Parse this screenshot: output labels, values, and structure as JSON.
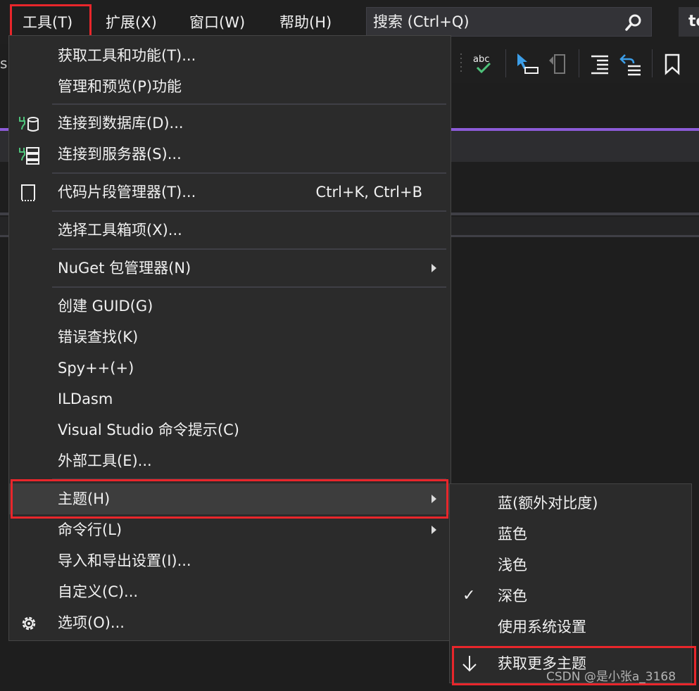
{
  "menubar": {
    "tools": "工具(T)",
    "extensions": "扩展(X)",
    "window": "窗口(W)",
    "help": "帮助(H)",
    "search_placeholder": "搜索 (Ctrl+Q)",
    "title_fragment": "te"
  },
  "background": {
    "left_letter": "s"
  },
  "tools_menu": {
    "items": [
      {
        "label": "获取工具和功能(T)..."
      },
      {
        "label": "管理和预览(P)功能"
      },
      {
        "label": "连接到数据库(D)...",
        "icon": "database-connect-icon"
      },
      {
        "label": "连接到服务器(S)...",
        "icon": "server-connect-icon"
      },
      {
        "label": "代码片段管理器(T)...",
        "icon": "snippet-icon",
        "shortcut": "Ctrl+K, Ctrl+B"
      },
      {
        "label": "选择工具箱项(X)..."
      },
      {
        "label": "NuGet 包管理器(N)",
        "has_submenu": true
      },
      {
        "label": "创建 GUID(G)"
      },
      {
        "label": "错误查找(K)"
      },
      {
        "label": "Spy++(+)"
      },
      {
        "label": "ILDasm"
      },
      {
        "label": "Visual Studio 命令提示(C)"
      },
      {
        "label": "外部工具(E)..."
      },
      {
        "label": "主题(H)",
        "has_submenu": true,
        "highlighted": true
      },
      {
        "label": "命令行(L)",
        "has_submenu": true
      },
      {
        "label": "导入和导出设置(I)..."
      },
      {
        "label": "自定义(C)..."
      },
      {
        "label": "选项(O)...",
        "icon": "gear-icon"
      }
    ]
  },
  "theme_submenu": {
    "items": [
      {
        "label": "蓝(额外对比度)"
      },
      {
        "label": "蓝色"
      },
      {
        "label": "浅色"
      },
      {
        "label": "深色",
        "checked": true,
        "check_mark": "✓"
      },
      {
        "label": "使用系统设置"
      },
      {
        "label": "获取更多主题",
        "icon": "download-arrow-icon"
      }
    ]
  },
  "watermark": "CSDN @是小张a_3168",
  "colors": {
    "highlight_border": "#e8262b",
    "accent_purple": "#8c5bd8",
    "menu_bg": "#2b2b2b"
  }
}
